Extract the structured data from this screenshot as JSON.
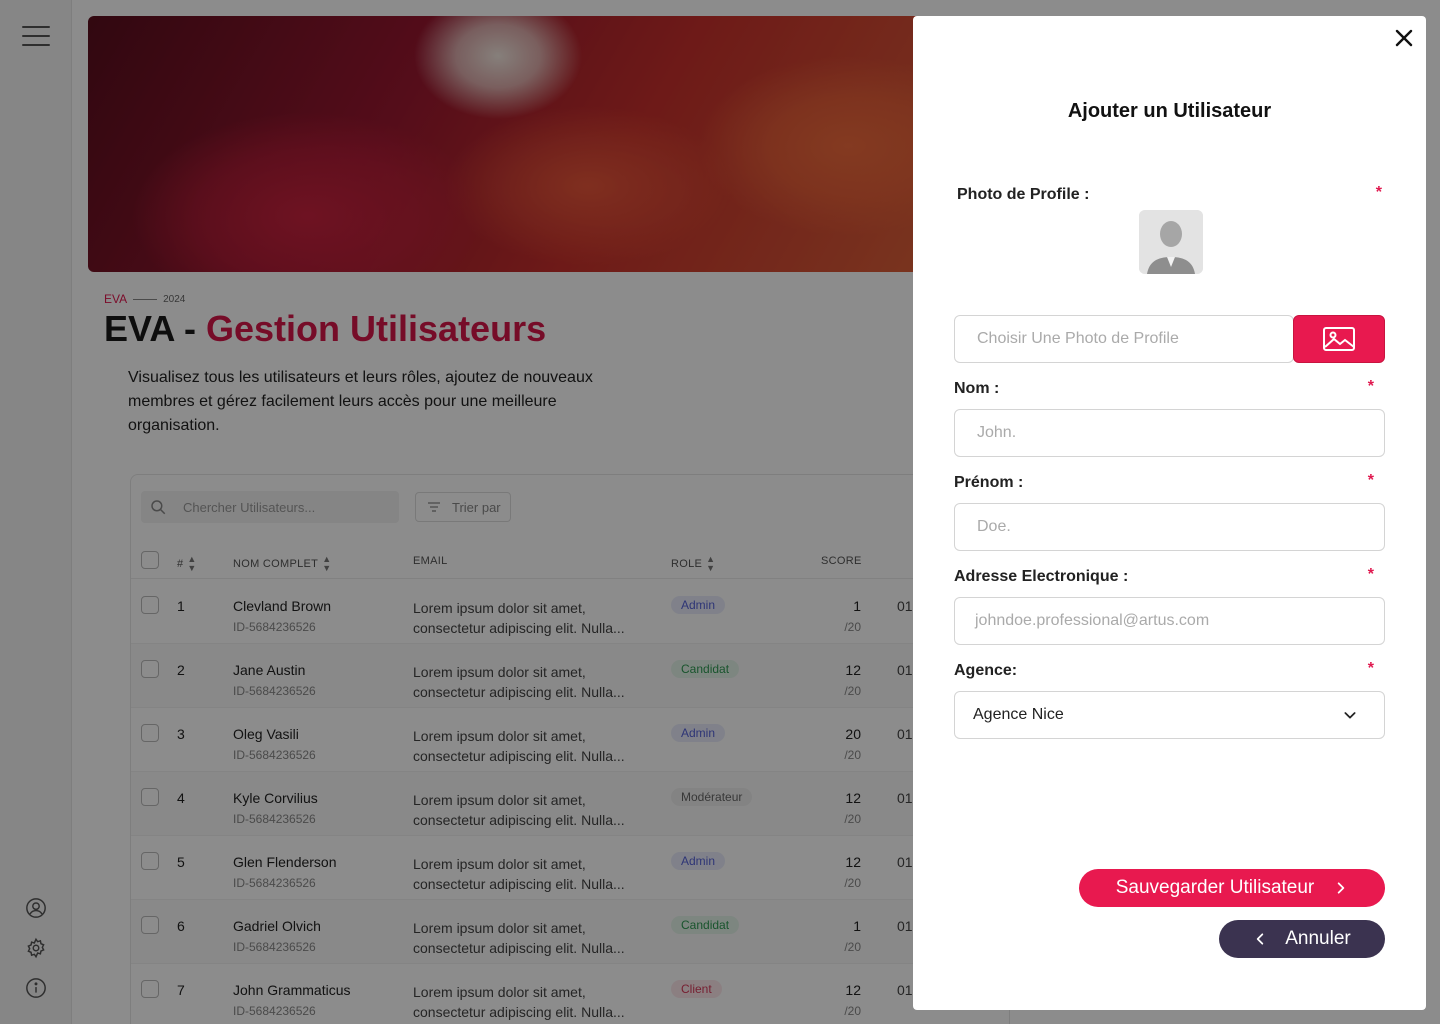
{
  "header": {
    "brand": "EVA",
    "year": "2024",
    "title_prefix": "EVA - ",
    "title_accent": "Gestion Utilisateurs",
    "description": "Visualisez tous les utilisateurs et leurs rôles, ajoutez de nouveaux membres et gérez facilement leurs accès pour une meilleure organisation."
  },
  "toolbar": {
    "search_placeholder": "Chercher Utilisateurs...",
    "sort_label": "Trier par"
  },
  "table": {
    "columns": [
      "#",
      "NOM COMPLET",
      "EMAIL",
      "ROLE",
      "SCORE"
    ],
    "rows": [
      {
        "num": "1",
        "name": "Clevland Brown",
        "id": "ID-5684236526",
        "email": "Lorem ipsum dolor sit amet, consectetur adipiscing elit. Nulla...",
        "role": "Admin",
        "score": "1",
        "score_max": "/20",
        "extra": "01"
      },
      {
        "num": "2",
        "name": "Jane Austin",
        "id": "ID-5684236526",
        "email": "Lorem ipsum dolor sit amet, consectetur adipiscing elit. Nulla...",
        "role": "Candidat",
        "score": "12",
        "score_max": "/20",
        "extra": "01"
      },
      {
        "num": "3",
        "name": "Oleg Vasili",
        "id": "ID-5684236526",
        "email": "Lorem ipsum dolor sit amet, consectetur adipiscing elit. Nulla...",
        "role": "Admin",
        "score": "20",
        "score_max": "/20",
        "extra": "01"
      },
      {
        "num": "4",
        "name": "Kyle Corvilius",
        "id": "ID-5684236526",
        "email": "Lorem ipsum dolor sit amet, consectetur adipiscing elit. Nulla...",
        "role": "Modérateur",
        "score": "12",
        "score_max": "/20",
        "extra": "01"
      },
      {
        "num": "5",
        "name": "Glen Flenderson",
        "id": "ID-5684236526",
        "email": "Lorem ipsum dolor sit amet, consectetur adipiscing elit. Nulla...",
        "role": "Admin",
        "score": "12",
        "score_max": "/20",
        "extra": "01"
      },
      {
        "num": "6",
        "name": "Gadriel Olvich",
        "id": "ID-5684236526",
        "email": "Lorem ipsum dolor sit amet, consectetur adipiscing elit. Nulla...",
        "role": "Candidat",
        "score": "1",
        "score_max": "/20",
        "extra": "01"
      },
      {
        "num": "7",
        "name": "John Grammaticus",
        "id": "ID-5684236526",
        "email": "Lorem ipsum dolor sit amet, consectetur adipiscing elit. Nulla...",
        "role": "Client",
        "score": "12",
        "score_max": "/20",
        "extra": "01"
      }
    ]
  },
  "drawer": {
    "title": "Ajouter un Utilisateur",
    "required_mark": "*",
    "photo_label": "Photo de Profile :",
    "photo_placeholder": "Choisir Une Photo de Profile",
    "nom_label": "Nom :",
    "nom_placeholder": "John.",
    "prenom_label": "Prénom :",
    "prenom_placeholder": "Doe.",
    "email_label": "Adresse Electronique :",
    "email_placeholder": "johndoe.professional@artus.com",
    "agence_label": "Agence:",
    "agence_value": "Agence Nice",
    "save_label": "Sauvegarder Utilisateur",
    "cancel_label": "Annuler"
  },
  "colors": {
    "accent": "#e8194f",
    "dark_button": "#3b3350",
    "badge_admin": "#5561d8",
    "badge_candidat": "#2e9a52",
    "badge_client": "#d83a5a"
  },
  "icons": [
    "menu-icon",
    "user-circle-icon",
    "gear-icon",
    "info-icon",
    "search-icon",
    "filter-icon",
    "sort-icon",
    "close-icon",
    "image-icon",
    "chevron-down-icon",
    "chevron-right-icon",
    "chevron-left-icon"
  ]
}
